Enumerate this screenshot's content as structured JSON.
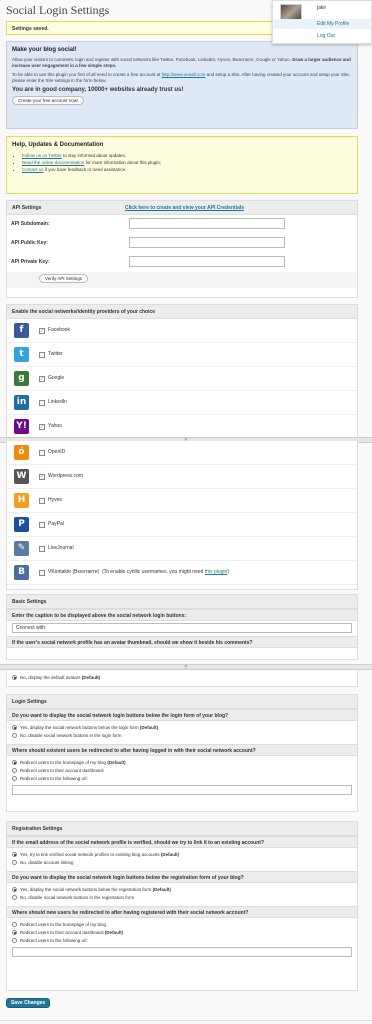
{
  "page": {
    "title": "Social Login Settings"
  },
  "user_menu": {
    "username": "jakir",
    "edit_profile": "Edit My Profile",
    "logout": "Log Out"
  },
  "notice": {
    "saved": "Settings saved."
  },
  "promo": {
    "heading": "Make your blog social!",
    "p1": "Allow your visitors to comment, login and register with social networks like Twitter, Facebook, LinkedIn, Hyves, Вконтакте, Google or Yahoo.",
    "p1_bold": "Draw a larger audience and increase user engagement in a few simple steps.",
    "p2a": "To be able to use this plugin you first of all need to create a free account at",
    "p2_link": "http://www.oneall.com",
    "p2b": "and setup a Site. After having created your account and setup your Site, please enter the Site settings in the form below.",
    "good": "You are in good company, 10000+ websites already trust us!",
    "create_btn": "Create your free account now!"
  },
  "help": {
    "heading": "Help, Updates & Documentation",
    "i1_link": "Follow us on Twitter",
    "i1_text": "to stay informed about updates;",
    "i2_link": "Read the online documentation",
    "i2_text": "for more information about this plugin;",
    "i3_link": "Contact us",
    "i3_text": "if you have feedback or need assistance."
  },
  "api": {
    "heading": "API Settings",
    "credentials_link": "Click here to create and view your API Credentials",
    "subdomain_label": "API Subdomain:",
    "public_label": "API Public Key:",
    "private_label": "API Private Key:",
    "verify_btn": "Verify API Settings"
  },
  "providers": {
    "heading": "Enable the social networks/identity providers of your choice",
    "items": [
      {
        "name": "Facebook",
        "checked": true,
        "icon": "facebook-icon",
        "color": "#3b5998",
        "glyph": "f"
      },
      {
        "name": "Twitter",
        "checked": false,
        "icon": "twitter-icon",
        "color": "#33a3d8",
        "glyph": "t"
      },
      {
        "name": "Google",
        "checked": true,
        "icon": "google-icon",
        "color": "#3a7a3a",
        "glyph": "g"
      },
      {
        "name": "LinkedIn",
        "checked": false,
        "icon": "linkedin-icon",
        "color": "#1e6ea1",
        "glyph": "in"
      },
      {
        "name": "Yahoo",
        "checked": true,
        "icon": "yahoo-icon",
        "color": "#6b0a8a",
        "glyph": "Y!"
      },
      {
        "name": "OpenID",
        "checked": false,
        "icon": "openid-icon",
        "color": "#f08a0c",
        "glyph": "ó"
      },
      {
        "name": "Wordpress.com",
        "checked": true,
        "icon": "wordpress-icon",
        "color": "#555555",
        "glyph": "W"
      },
      {
        "name": "Hyves",
        "checked": false,
        "icon": "hyves-icon",
        "color": "#f0a020",
        "glyph": "H"
      },
      {
        "name": "PayPal",
        "checked": false,
        "icon": "paypal-icon",
        "color": "#1f4e9c",
        "glyph": "P"
      },
      {
        "name": "LiveJournal",
        "checked": false,
        "icon": "livejournal-icon",
        "color": "#5a7aa0",
        "glyph": "✎"
      },
      {
        "name": "VKontakte (Вконтакте)",
        "checked": false,
        "icon": "vkontakte-icon",
        "color": "#4a6ea0",
        "glyph": "B"
      }
    ],
    "vk_note": "(To enable cyrillic usernames, you might need",
    "vk_link": "this plugin",
    "vk_close": ")"
  },
  "basic": {
    "heading": "Basic Settings",
    "caption_q": "Enter the caption to be displayed above the social network login buttons:",
    "caption_value": "Connect with:",
    "avatar_q": "If the user's social network profile has an avatar thumbnail, should we show it beside his comments?",
    "avatar_no": "No, display the default avatars",
    "default": "(Default)"
  },
  "login": {
    "heading": "Login Settings",
    "q1": "Do you want to display the social network login buttons below the login form of your blog?",
    "q1_yes": "Yes, display the social network buttons below the login form",
    "q1_no": "No, disable social network buttons in the login form",
    "q2": "Where should existent users be redirected to after having logged in with their social network account?",
    "q2_a": "Redirect users to the homepage of my blog",
    "q2_b": "Redirect users to their account dashboard",
    "q2_c": "Redirect users to the following url:"
  },
  "registration": {
    "heading": "Registration Settings",
    "q1": "If the email address of the social network profile is verified, should we try to link it to an existing account?",
    "q1_yes": "Yes, try to link verified social network profiles to existing blog accounts",
    "q1_no": "No, disable account linking",
    "q2": "Do you want to display the social network login buttons below the registration form of your blog?",
    "q2_yes": "Yes, display the social network buttons below the registration form",
    "q2_no": "No, disable social network buttons in the registration form",
    "q3": "Where should new users be redirected to after having registered with their social network account?",
    "q3_a": "Redirect users to the homepage of my blog",
    "q3_b": "Redirect users to their account dashboard",
    "q3_c": "Redirect users to the following url:"
  },
  "save_btn": "Save Changes",
  "grip": "⠿"
}
